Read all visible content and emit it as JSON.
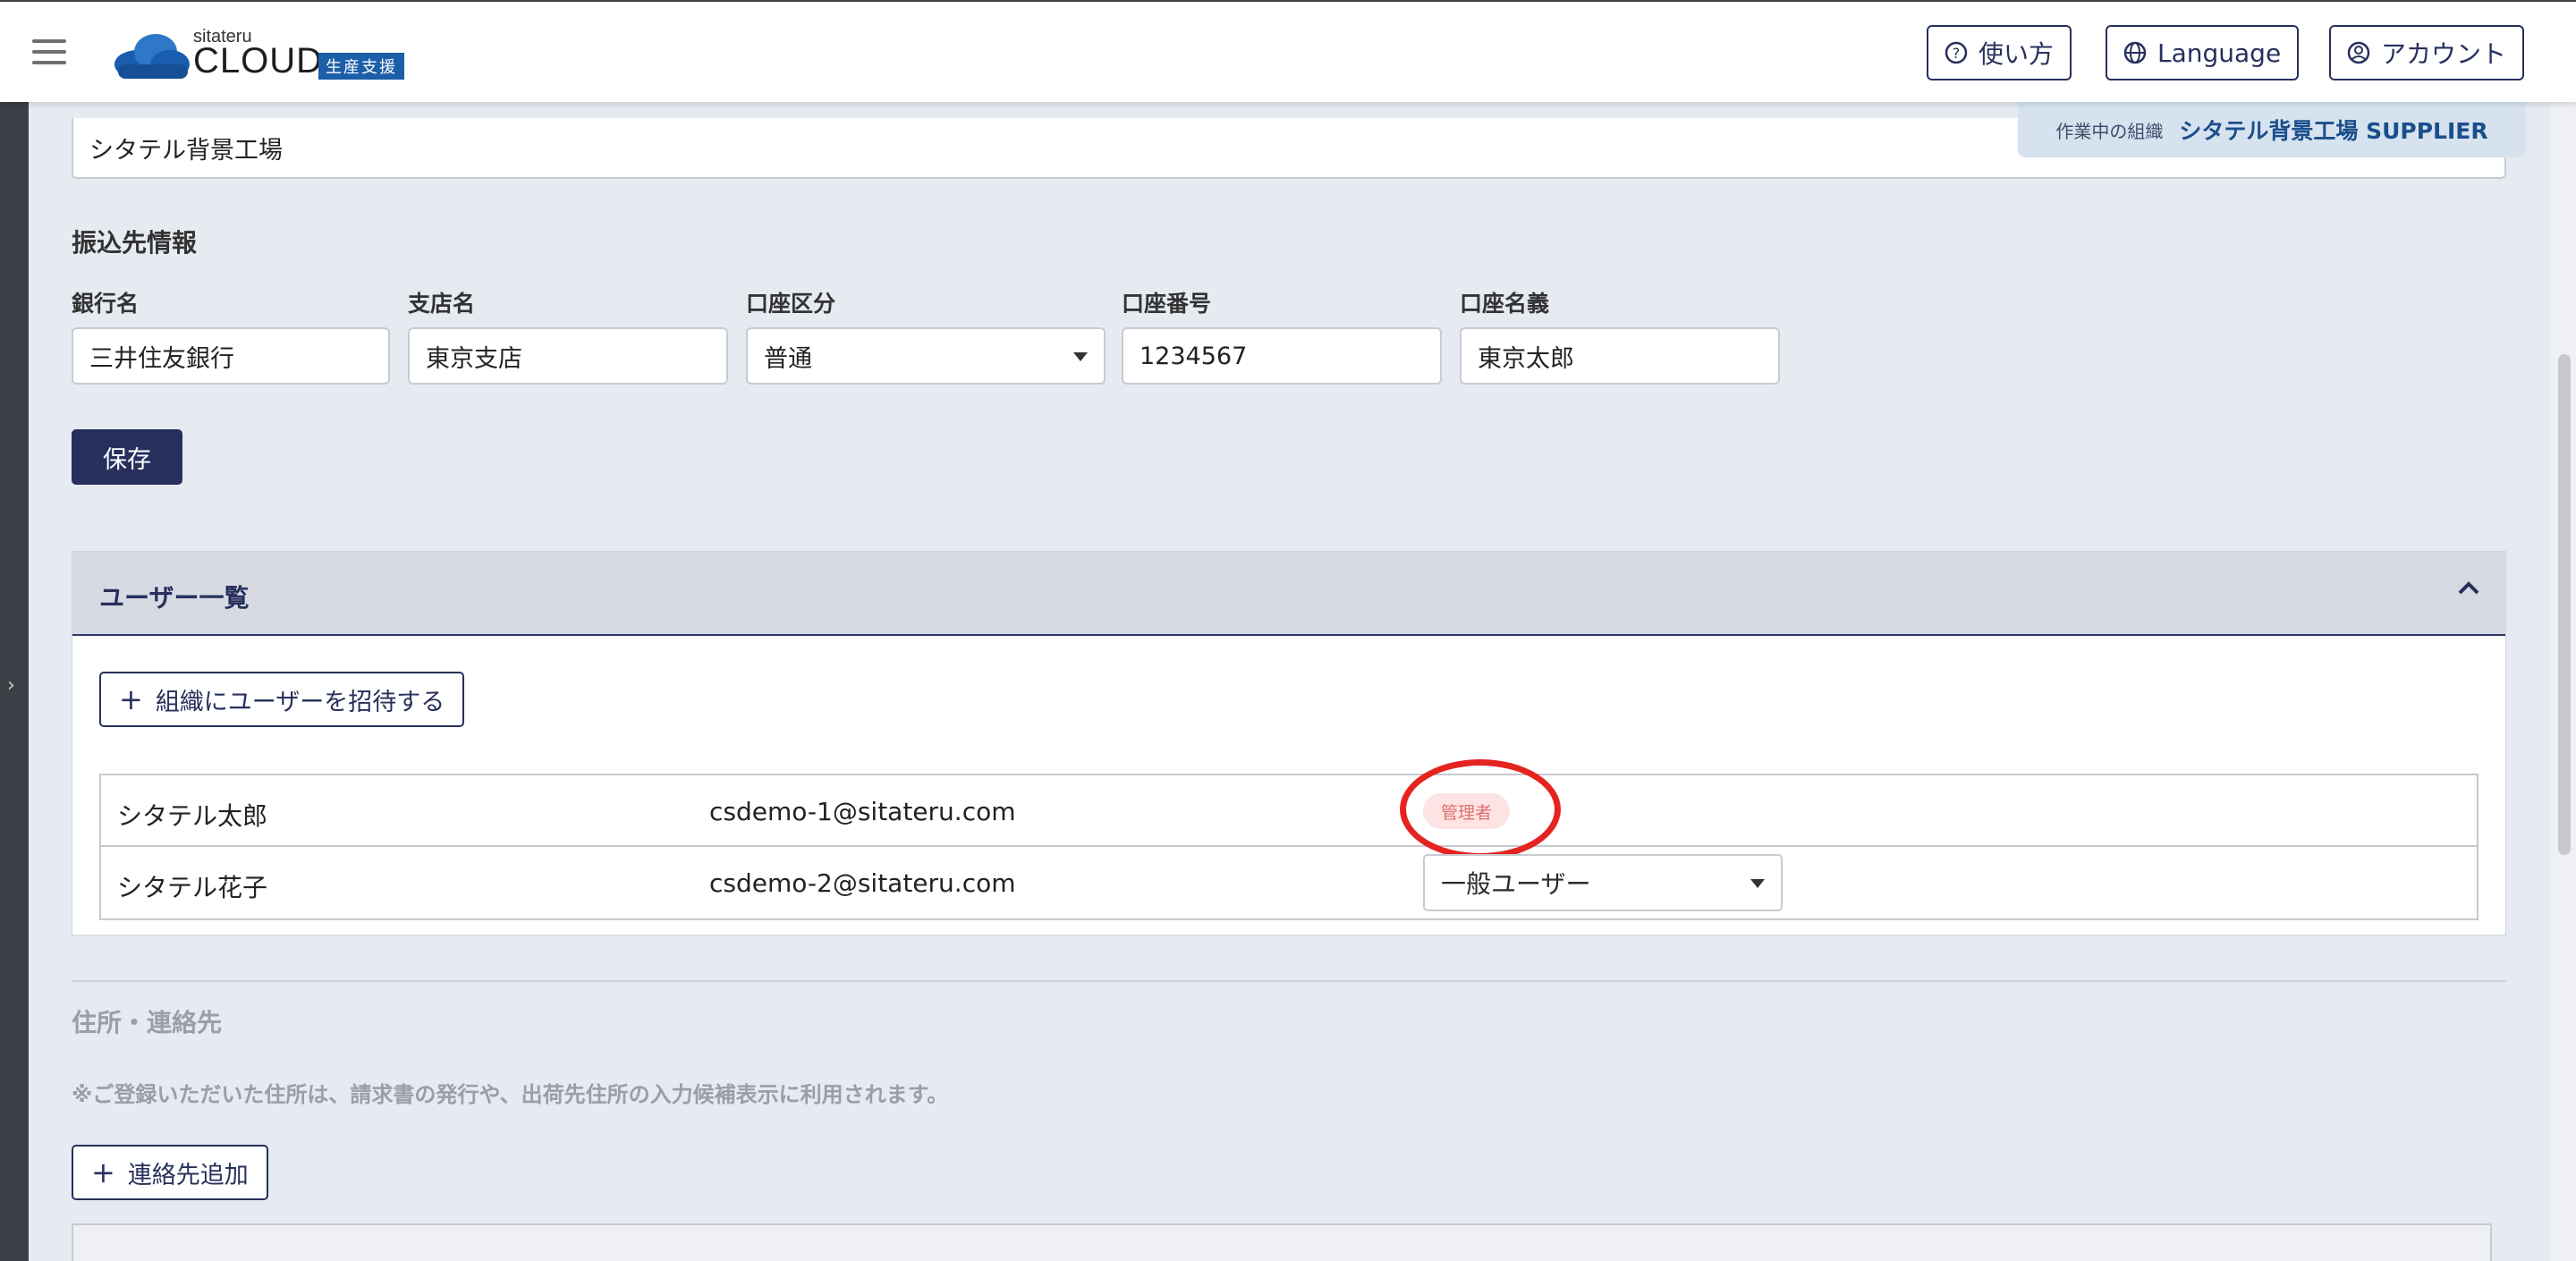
{
  "header": {
    "logo_sub": "sitateru",
    "logo_main": "CLOUD",
    "logo_badge": "生産支援",
    "help_label": "使い方",
    "language_label": "Language",
    "account_label": "アカウント"
  },
  "org": {
    "label": "作業中の組織",
    "name": "シタテル背景工場 SUPPLIER"
  },
  "company_name_value": "シタテル背景工場",
  "bank": {
    "section_title": "振込先情報",
    "bank_name_label": "銀行名",
    "bank_name_value": "三井住友銀行",
    "branch_label": "支店名",
    "branch_value": "東京支店",
    "account_type_label": "口座区分",
    "account_type_value": "普通",
    "account_number_label": "口座番号",
    "account_number_value": "1234567",
    "account_holder_label": "口座名義",
    "account_holder_value": "東京太郎",
    "save_label": "保存"
  },
  "users": {
    "panel_title": "ユーザー一覧",
    "invite_label": "組織にユーザーを招待する",
    "rows": [
      {
        "name": "シタテル太郎",
        "email": "csdemo-1@sitateru.com",
        "role": "管理者"
      },
      {
        "name": "シタテル花子",
        "email": "csdemo-2@sitateru.com",
        "role": "一般ユーザー"
      }
    ]
  },
  "address": {
    "section_title": "住所・連絡先",
    "note": "※ご登録いただいた住所は、請求書の発行や、出荷先住所の入力候補表示に利用されます。",
    "add_label": "連絡先追加"
  },
  "colors": {
    "navy": "#27305c",
    "brand_blue": "#1c5ea8",
    "admin_badge_bg": "#fde3e3",
    "highlight_circle": "#e52420"
  }
}
